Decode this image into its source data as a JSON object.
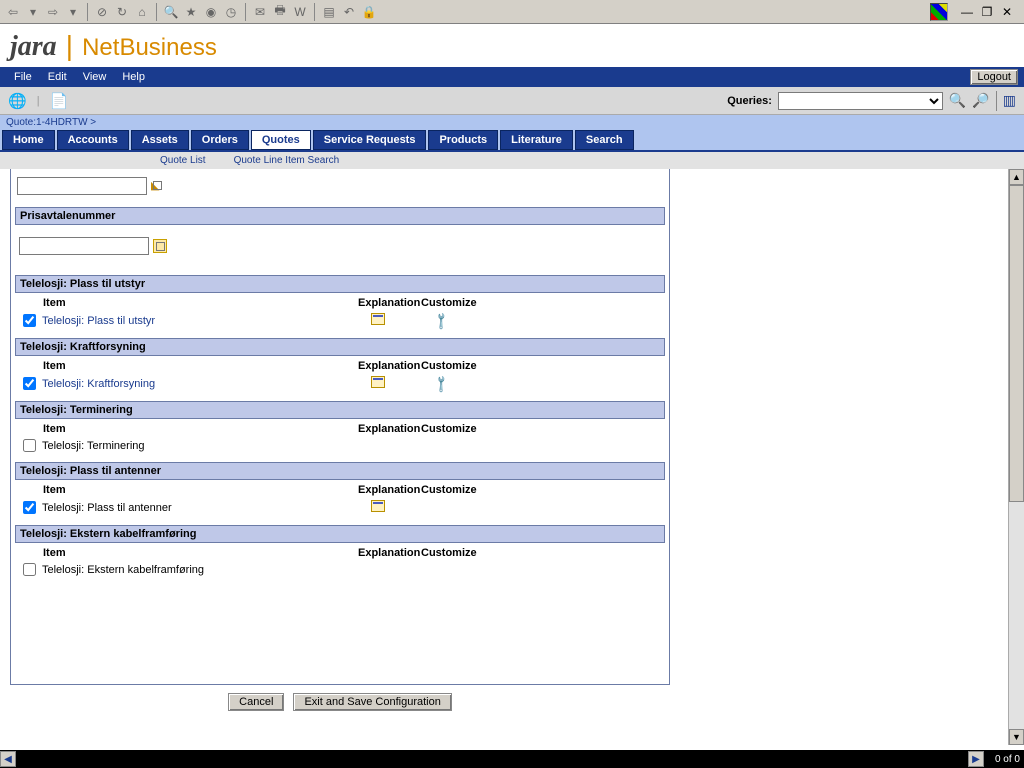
{
  "menubar": {
    "file": "File",
    "edit": "Edit",
    "view": "View",
    "help": "Help",
    "logout": "Logout"
  },
  "logo": {
    "brand1": "jara",
    "brand2": "NetBusiness"
  },
  "querybar": {
    "label": "Queries:"
  },
  "breadcrumb": {
    "text": "Quote:1-4HDRTW  >"
  },
  "tabs": {
    "home": "Home",
    "accounts": "Accounts",
    "assets": "Assets",
    "orders": "Orders",
    "quotes": "Quotes",
    "service": "Service Requests",
    "products": "Products",
    "literature": "Literature",
    "search": "Search"
  },
  "subtabs": {
    "list": "Quote List",
    "lineitem": "Quote Line Item Search"
  },
  "sections": {
    "prisavtale": {
      "title": "Prisavtalenummer"
    },
    "cols": {
      "item": "Item",
      "explanation": "Explanation",
      "customize": "Customize"
    },
    "s1": {
      "title": "Telelosji: Plass til utstyr",
      "item": "Telelosji: Plass til utstyr",
      "checked": true,
      "link": true,
      "explain": true,
      "wrench": true
    },
    "s2": {
      "title": "Telelosji: Kraftforsyning",
      "item": "Telelosji: Kraftforsyning",
      "checked": true,
      "link": true,
      "explain": true,
      "wrench": true
    },
    "s3": {
      "title": "Telelosji: Terminering",
      "item": "Telelosji: Terminering",
      "checked": false,
      "link": false,
      "explain": false,
      "wrench": false
    },
    "s4": {
      "title": "Telelosji: Plass til antenner",
      "item": "Telelosji: Plass til antenner",
      "checked": true,
      "link": false,
      "explain": true,
      "wrench": false
    },
    "s5": {
      "title": "Telelosji: Ekstern kabelframføring",
      "item": "Telelosji: Ekstern kabelframføring",
      "checked": false,
      "link": false,
      "explain": false,
      "wrench": false
    }
  },
  "buttons": {
    "cancel": "Cancel",
    "save": "Exit and Save Configuration"
  },
  "status": {
    "count": "0 of 0"
  }
}
